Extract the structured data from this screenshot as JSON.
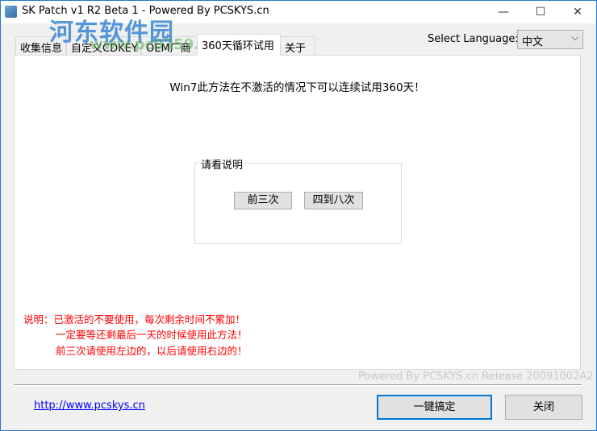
{
  "window": {
    "title": "SK Patch v1 R2 Beta 1 - Powered By PCSKYS.cn",
    "minimize": "—",
    "maximize": "☐",
    "close": "✕"
  },
  "watermark": {
    "text": "河东软件园",
    "url": "www.pc0359.cn"
  },
  "tabs": [
    "收集信息",
    "自定义CDKEY",
    "OEM厂商",
    "360天循环试用",
    "关于"
  ],
  "language": {
    "label": "Select Language:",
    "value": "中文"
  },
  "panel": {
    "headline": "Win7此方法在不激活的情况下可以连续试用360天！",
    "group_title": "请看说明",
    "btn_first": "前三次",
    "btn_second": "四到八次",
    "notes": [
      "说明：已激活的不要使用，每次剩余时间不累加！",
      "一定要等还剩最后一天的时候使用此方法！",
      "前三次请使用左边的，以后请使用右边的！"
    ]
  },
  "release": "Powered By PCSKYS.cn Release 20091002A2",
  "footer": {
    "link": "http://www.pcskys.cn",
    "primary": "一键搞定",
    "close": "关闭"
  }
}
